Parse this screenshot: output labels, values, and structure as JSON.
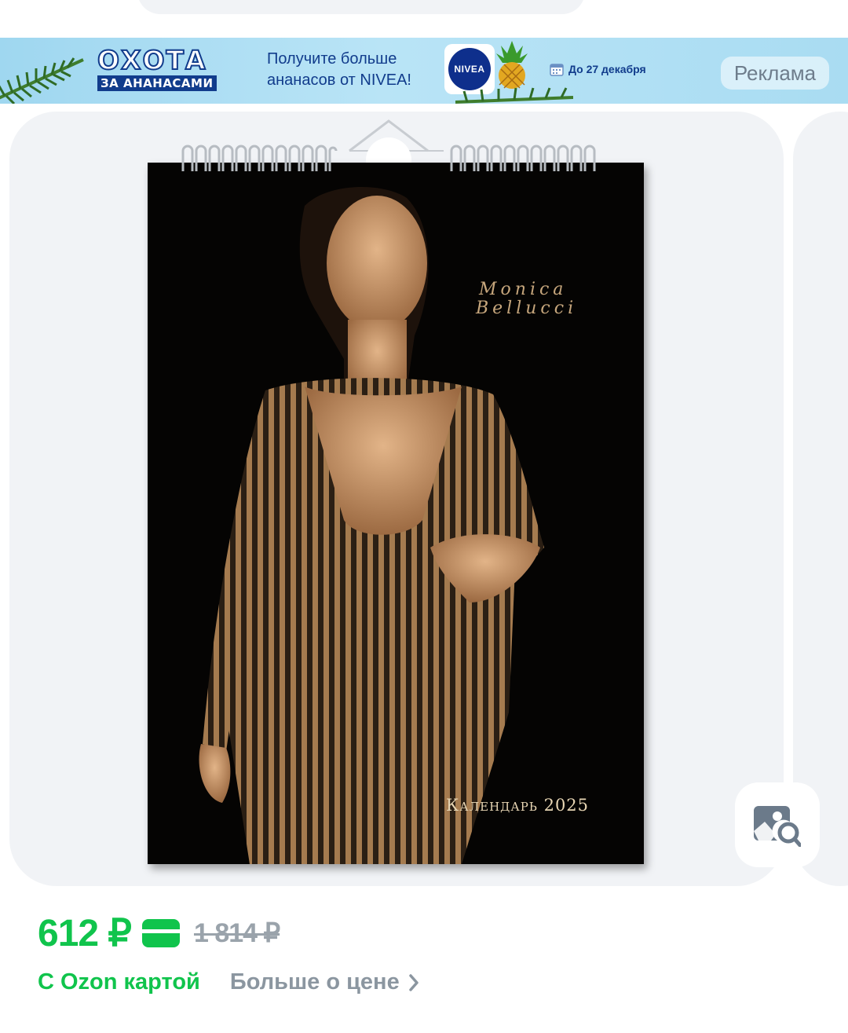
{
  "ad": {
    "title": "ОХОТА",
    "subtitle": "ЗА АНАНАСАМИ",
    "text_line1": "Получите больше",
    "text_line2": "ананасов от NIVEA!",
    "brand": "NIVEA",
    "date": "До 27 декабря",
    "label": "Реклама"
  },
  "product": {
    "signature_line1": "Monica",
    "signature_line2": "Bellucci",
    "calendar_title": "Календарь 2025"
  },
  "pricing": {
    "price": "612 ₽",
    "old_price": "1 814 ₽",
    "ozon_card": "С Ozon картой",
    "more_info": "Больше о цене"
  },
  "colors": {
    "accent_green": "#10c44c",
    "ad_blue": "#113c8c",
    "muted_gray": "#8b96a0"
  },
  "icons": [
    "calendar-icon",
    "nivea-logo-icon",
    "pineapple-icon",
    "fir-branch-icon",
    "card-icon",
    "image-search-icon",
    "chevron-right-icon"
  ]
}
